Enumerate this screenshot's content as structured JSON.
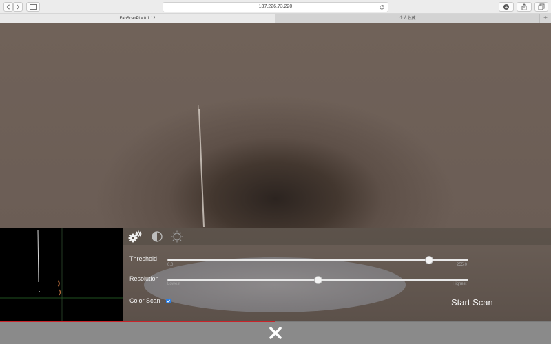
{
  "browser": {
    "url": "137.226.73.220",
    "icons": {
      "back": "chevron-left-icon",
      "forward": "chevron-right-icon",
      "sidebar": "sidebar-icon",
      "reload": "reload-icon",
      "download": "download-icon",
      "share": "share-icon",
      "tabs": "tabs-overview-icon",
      "new_tab": "plus-icon"
    }
  },
  "tabs": [
    {
      "label": "FabScanPi v.0.1.12"
    },
    {
      "label": "个人收藏"
    }
  ],
  "settings": {
    "tab_icons": [
      "gears-icon",
      "contrast-icon",
      "brightness-icon"
    ],
    "threshold": {
      "label": "Threshold",
      "min_label": "0.0",
      "max_label": "255.0",
      "value": 222
    },
    "resolution": {
      "label": "Resolution",
      "min_label": "Lowest",
      "max_label": "Highest",
      "value": 0.5
    },
    "color_scan": {
      "label": "Color Scan",
      "checked": true
    },
    "start_button": "Start Scan"
  },
  "progress": {
    "fraction": 0.5
  },
  "colors": {
    "accent": "#2a7fe6",
    "progress": "#c8242a"
  }
}
